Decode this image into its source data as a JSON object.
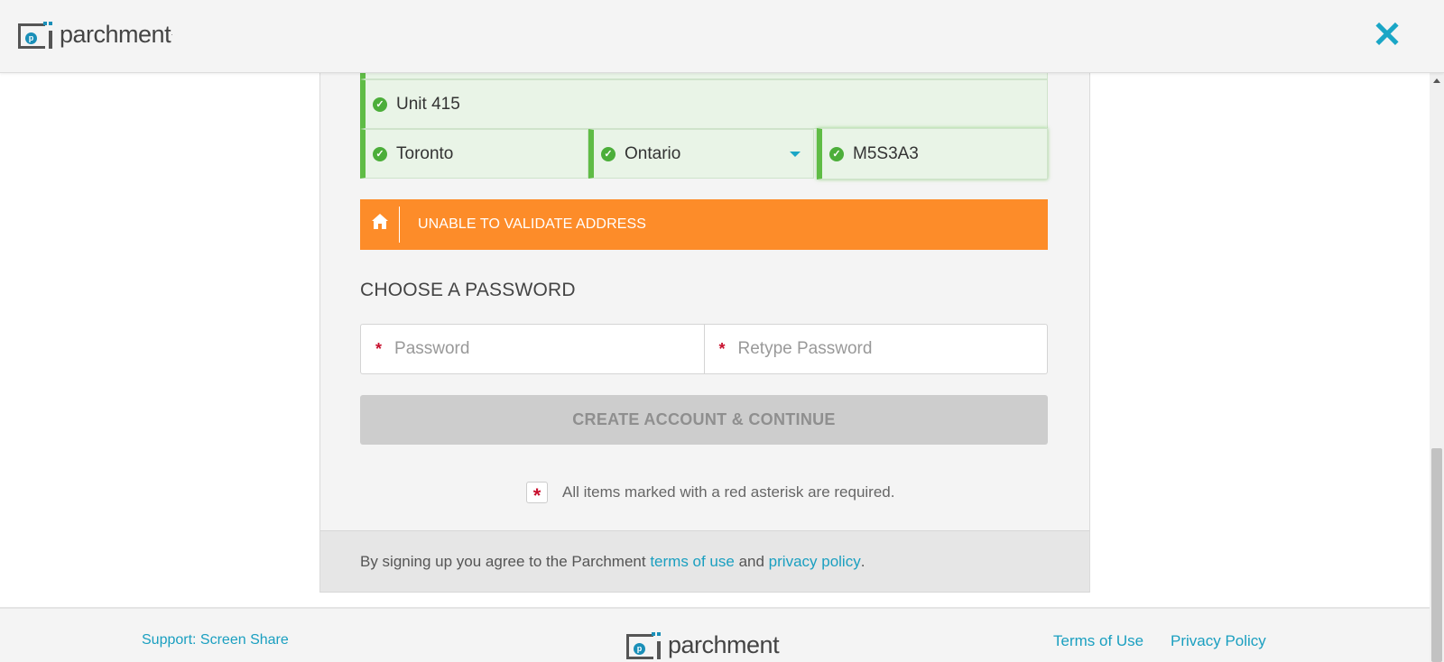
{
  "header": {
    "logo_text": "parchment",
    "logo_mark_letter": "p",
    "close_glyph": "✕"
  },
  "address": {
    "line2": "Unit 415",
    "city": "Toronto",
    "province": "Ontario",
    "postal_code": "M5S3A3",
    "check_glyph": "✓"
  },
  "alert": {
    "text": "UNABLE TO VALIDATE ADDRESS",
    "icon": "home-icon"
  },
  "password_section": {
    "title": "CHOOSE A PASSWORD",
    "password_placeholder": "Password",
    "retype_placeholder": "Retype Password",
    "asterisk": "*"
  },
  "submit": {
    "label": "CREATE ACCOUNT & CONTINUE"
  },
  "required_note": {
    "asterisk": "*",
    "text": "All items marked with a red asterisk are required."
  },
  "terms": {
    "prefix": "By signing up you agree to the Parchment ",
    "terms_link": "terms of use",
    "middle": " and ",
    "privacy_link": "privacy policy",
    "suffix": "."
  },
  "page_footer": {
    "support_link": "Support: Screen Share",
    "logo_text": "parchment",
    "logo_mark_letter": "p",
    "terms_link": "Terms of Use",
    "privacy_link": "Privacy Policy"
  },
  "colors": {
    "accent": "#1aa6c6",
    "alert": "#fd8c29",
    "valid_green": "#5fbc45",
    "required_red": "#c8102e"
  }
}
